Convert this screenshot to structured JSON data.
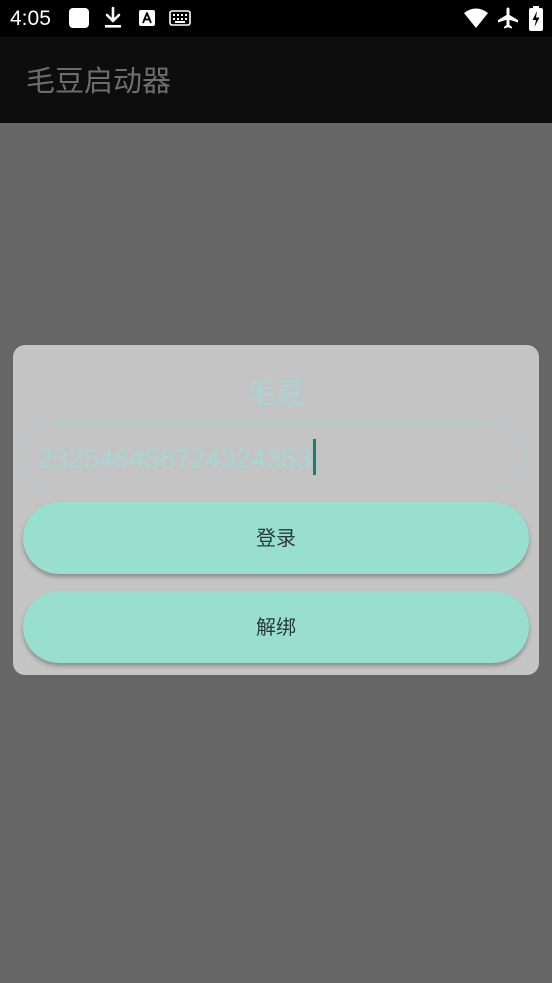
{
  "status_bar": {
    "time": "4:05",
    "icons": [
      "app-square-icon",
      "download-icon",
      "text-a-icon",
      "keyboard-icon",
      "wifi-icon",
      "airplane-mode-icon",
      "battery-charging-icon"
    ]
  },
  "app_bar": {
    "title": "毛豆启动器"
  },
  "dialog": {
    "title": "毛豆",
    "id_input_value": "232546456724324353",
    "login_label": "登录",
    "unbind_label": "解绑"
  },
  "colors": {
    "accent": "#98dfcf",
    "caret": "#0a8572",
    "dialog_bg": "#c4c4c4",
    "scrim": "#666666"
  }
}
